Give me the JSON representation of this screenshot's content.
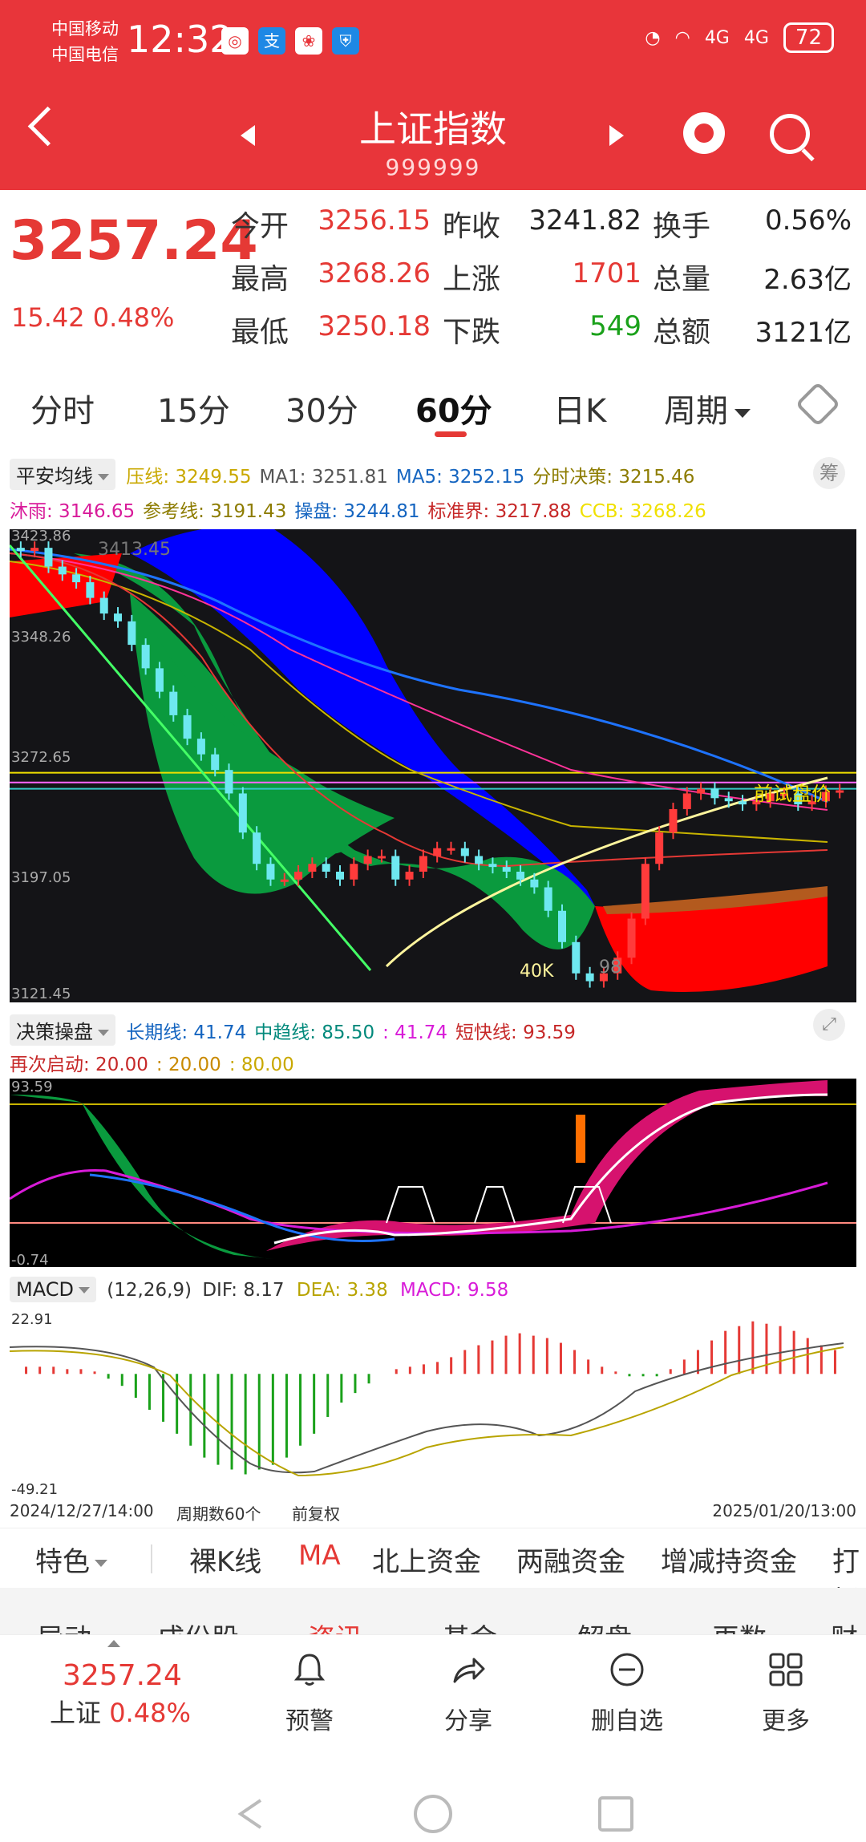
{
  "status_bar": {
    "carrier1": "中国移动",
    "carrier2": "中国电信",
    "time": "12:32",
    "battery": "72",
    "net1": "4G",
    "net2": "4G"
  },
  "header": {
    "title": "上证指数",
    "code": "999999"
  },
  "quote": {
    "price": "3257.24",
    "change": "15.42 0.48%",
    "rows": [
      [
        {
          "label": "今开",
          "value": "3256.15",
          "color": "red"
        },
        {
          "label": "昨收",
          "value": "3241.82",
          "color": "dark"
        },
        {
          "label": "换手",
          "value": "0.56%",
          "color": "dark"
        }
      ],
      [
        {
          "label": "最高",
          "value": "3268.26",
          "color": "red"
        },
        {
          "label": "上涨",
          "value": "1701",
          "color": "red"
        },
        {
          "label": "总量",
          "value": "2.63亿",
          "color": "dark"
        }
      ],
      [
        {
          "label": "最低",
          "value": "3250.18",
          "color": "red"
        },
        {
          "label": "下跌",
          "value": "549",
          "color": "green"
        },
        {
          "label": "总额",
          "value": "3121亿",
          "color": "dark"
        }
      ]
    ]
  },
  "tabs": [
    "分时",
    "15分",
    "30分",
    "60分",
    "日K",
    "周期"
  ],
  "main_indicator": {
    "chip": "平安均线",
    "items1": [
      {
        "t": "压线: 3249.55",
        "c": "#c9a800"
      },
      {
        "t": "MA1: 3251.81",
        "c": "#555"
      },
      {
        "t": "MA5: 3252.15",
        "c": "#1565c0"
      },
      {
        "t": "分时决策: 3215.46",
        "c": "#8d7c00"
      }
    ],
    "items2": [
      {
        "t": "沐雨: 3146.65",
        "c": "#d81b9a"
      },
      {
        "t": "参考线: 3191.43",
        "c": "#8d7c00"
      },
      {
        "t": "操盘: 3244.81",
        "c": "#1565c0"
      },
      {
        "t": "标准界: 3217.88",
        "c": "#c62828"
      },
      {
        "t": "CCB: 3268.26",
        "c": "#f0e000"
      }
    ],
    "chou": "筹",
    "y_labels": [
      "3423.86",
      "3348.26",
      "3272.65",
      "3197.05",
      "3121.45"
    ],
    "annotations": {
      "top": "3413.45",
      "low": "40K",
      "low2": "98",
      "right": "前试盘价"
    }
  },
  "decision_indicator": {
    "chip": "决策操盘",
    "items1": [
      {
        "t": "长期线: 41.74",
        "c": "#1565c0"
      },
      {
        "t": "中趋线: 85.50",
        "c": "#00897b"
      },
      {
        "t": ": 41.74",
        "c": "#d81bd8"
      },
      {
        "t": "短快线: 93.59",
        "c": "#c62828"
      }
    ],
    "items2": [
      {
        "t": "再次启动: 20.00",
        "c": "#c62828"
      },
      {
        "t": ": 20.00",
        "c": "#c98a00"
      },
      {
        "t": ": 80.00",
        "c": "#c9a800"
      }
    ],
    "y_labels": [
      "93.59",
      "-0.74"
    ]
  },
  "macd": {
    "chip": "MACD",
    "params": "(12,26,9)",
    "dif": "DIF: 8.17",
    "dea": "DEA: 3.38",
    "macd": "MACD: 9.58",
    "y_labels": [
      "22.91",
      "-49.21"
    ]
  },
  "bottom_axis": {
    "start": "2024/12/27/14:00",
    "period": "周期数60个",
    "adjust": "前复权",
    "end": "2025/01/20/13:00"
  },
  "feature_tabs": [
    "特色",
    "裸K线",
    "MA",
    "北上资金",
    "两融资金",
    "增减持资金",
    "打板"
  ],
  "sub_tabs": [
    "异动",
    "成份股",
    "资讯",
    "基金",
    "解盘",
    "再数",
    "财"
  ],
  "toolbar": {
    "price": "3257.24",
    "name": "上证",
    "pct": "0.48%",
    "items": [
      "预警",
      "分享",
      "删自选",
      "更多"
    ]
  },
  "chart_data": [
    {
      "type": "candlestick",
      "title": "",
      "y_axis_labels": [
        "3423.86",
        "3348.26",
        "3272.65",
        "3197.05",
        "3121.45"
      ],
      "ylim": [
        3121.45,
        3423.86
      ],
      "close_values": [
        3410,
        3412,
        3400,
        3395,
        3390,
        3380,
        3370,
        3365,
        3350,
        3335,
        3320,
        3305,
        3290,
        3280,
        3270,
        3255,
        3230,
        3210,
        3200,
        3200,
        3205,
        3210,
        3205,
        3200,
        3210,
        3215,
        3215,
        3200,
        3205,
        3215,
        3220,
        3220,
        3215,
        3210,
        3208,
        3205,
        3200,
        3195,
        3180,
        3160,
        3140,
        3135,
        3140,
        3150,
        3175,
        3210,
        3230,
        3245,
        3255,
        3258,
        3252,
        3250,
        3248,
        3250,
        3255,
        3255,
        3248,
        3250,
        3256,
        3257
      ]
    },
    {
      "type": "line",
      "title": "决策操盘",
      "ylim": [
        -0.74,
        93.59
      ],
      "series": [
        {
          "name": "长期线",
          "final": 41.74
        },
        {
          "name": "中趋线",
          "final": 85.5
        },
        {
          "name": "短快线",
          "final": 93.59
        }
      ]
    },
    {
      "type": "bar",
      "title": "MACD",
      "ylim": [
        -49.21,
        22.91
      ],
      "series": [
        {
          "name": "DIF",
          "final": 8.17
        },
        {
          "name": "DEA",
          "final": 3.38
        },
        {
          "name": "MACD",
          "final": 9.58
        }
      ],
      "macd_values": [
        3,
        3,
        3,
        2,
        2,
        1,
        -2,
        -5,
        -10,
        -15,
        -20,
        -25,
        -30,
        -35,
        -38,
        -40,
        -42,
        -40,
        -38,
        -35,
        -30,
        -25,
        -18,
        -12,
        -8,
        -4,
        0,
        2,
        3,
        4,
        5,
        7,
        10,
        12,
        14,
        16,
        17,
        16,
        15,
        13,
        10,
        6,
        3,
        1,
        -1,
        -1,
        -1,
        2,
        6,
        10,
        14,
        18,
        20,
        22,
        21,
        20,
        18,
        15,
        12,
        10
      ]
    }
  ]
}
